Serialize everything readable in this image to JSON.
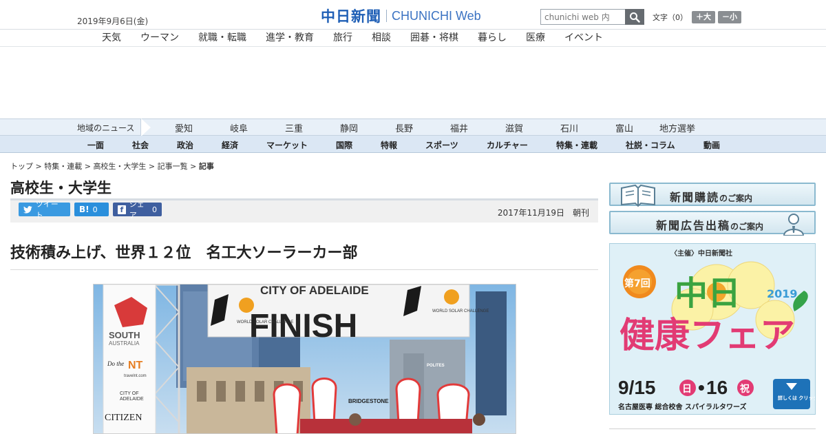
{
  "header": {
    "date": "2019年9月6日(金)",
    "logo_main": "中日新聞",
    "logo_sub": "CHUNICHI",
    "logo_web": "Web",
    "search_placeholder": "chunichi web 内",
    "font_label": "文字（0）",
    "font_plus": "＋大",
    "font_minus": "－小"
  },
  "subnav": [
    "天気",
    "ウーマン",
    "就職・転職",
    "進学・教育",
    "旅行",
    "相談",
    "囲碁・将棋",
    "暮らし",
    "医療",
    "イベント"
  ],
  "regionbar": {
    "title": "地域のニュース",
    "items": [
      "愛知",
      "岐阜",
      "三重",
      "静岡",
      "長野",
      "福井",
      "滋賀",
      "石川",
      "富山",
      "地方選挙"
    ]
  },
  "mainnav": [
    "一面",
    "社会",
    "政治",
    "経済",
    "マーケット",
    "国際",
    "特報",
    "スポーツ",
    "カルチャー",
    "特集・連載",
    "社説・コラム",
    "動画"
  ],
  "breadcrumb": {
    "items": [
      "トップ",
      "特集・連載",
      "高校生・大学生",
      "記事一覧"
    ],
    "current": "記事",
    "sep": " > "
  },
  "article": {
    "section": "高校生・大学生",
    "share_tweet": "ツイート",
    "share_hatena_count": "0",
    "share_fb": "シェア",
    "share_fb_count": "0",
    "pubdate": "2017年11月19日　朝刊",
    "headline": "技術積み上げ、世界１２位　名工大ソーラーカー部",
    "photo": {
      "finish": "FINISH",
      "banner_top": "CITY OF ADELAIDE",
      "wsc": "WORLD SOLAR CHALLENGE",
      "south": "SOUTH",
      "australia": "AUSTRALIA",
      "doit": "Do the",
      "nt": "NT",
      "travelnt": "travelnt.com",
      "city_of": "CITY OF",
      "adelaide": "ADELAIDE",
      "citizen": "CITIZEN",
      "bridgestone": "BRIDGESTONE",
      "polites": "POLITES"
    }
  },
  "sidebar": {
    "subscribe": "新聞購読",
    "subscribe_small": "のご案内",
    "ad": "新聞広告出稿",
    "ad_small": "のご案内",
    "fair": {
      "sponsor": "〈主催〉中日新聞社",
      "edition": "第7回",
      "title_line1": "中日",
      "title_line2": "健康フェア",
      "year": "2019",
      "dates_a": "9/15",
      "dow_a": "日",
      "dot": "•",
      "dates_b": "16",
      "dow_b": "祝",
      "venue": "名古屋医専 総合校舎 スパイラルタワーズ",
      "detail": "詳しくは クリック"
    }
  },
  "colors": {
    "brand_blue": "#1f5fb6",
    "twitter": "#3a9ae1",
    "hatena": "#2a8fdc",
    "facebook": "#3f5f9f",
    "nav_bg": "#dbe7f4",
    "region_bg": "#e8f0f8"
  }
}
